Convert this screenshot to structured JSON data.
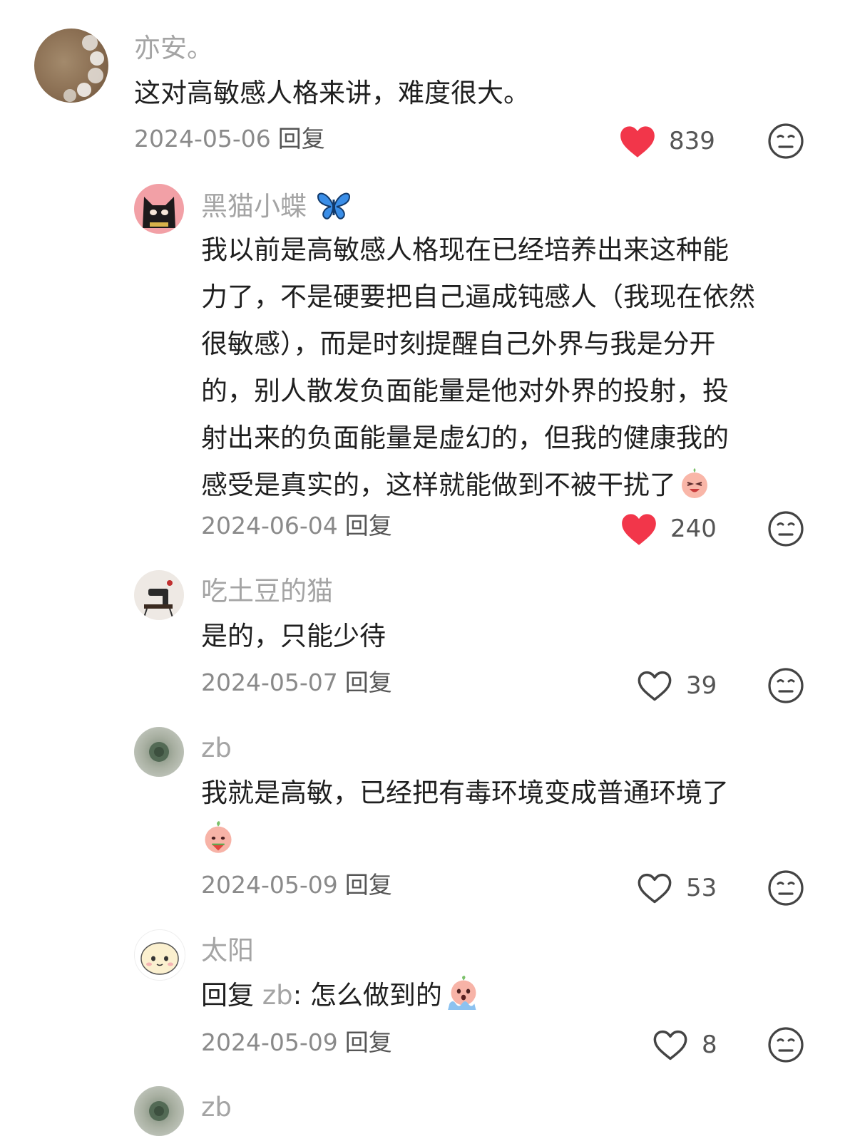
{
  "comments": [
    {
      "name": "亦安。",
      "text": "这对高敏感人格来讲，难度很大。",
      "date": "2024-05-06",
      "reply_label": "回复",
      "likes": "839",
      "liked": true
    },
    {
      "name": "黑猫小蝶",
      "name_emoji": "butterfly-icon",
      "text_lines": [
        "我以前是高敏感人格现在已经培养出来这种能",
        "力了，不是硬要把自己逼成钝感人（我现在依然",
        "很敏感），而是时刻提醒自己外界与我是分开",
        "的，别人散发负面能量是他对外界的投射，投",
        "射出来的负面能量是虚幻的，但我的健康我的",
        "感受是真实的，这样就能做到不被干扰了"
      ],
      "date": "2024-06-04",
      "reply_label": "回复",
      "likes": "240",
      "liked": true
    },
    {
      "name": "吃土豆的猫",
      "text": "是的，只能少待",
      "date": "2024-05-07",
      "reply_label": "回复",
      "likes": "39",
      "liked": false
    },
    {
      "name": "zb",
      "text": "我就是高敏，已经把有毒环境变成普通环境了",
      "date": "2024-05-09",
      "reply_label": "回复",
      "likes": "53",
      "liked": false
    },
    {
      "name": "太阳",
      "reply_prefix": "回复",
      "reply_to": "zb",
      "text": ": 怎么做到的",
      "date": "2024-05-09",
      "reply_label": "回复",
      "likes": "8",
      "liked": false
    },
    {
      "name": "zb"
    }
  ],
  "colors": {
    "heart_red": "#f2364a",
    "name_gray": "#a4a4a4",
    "meta_gray": "#8a8a8a"
  }
}
